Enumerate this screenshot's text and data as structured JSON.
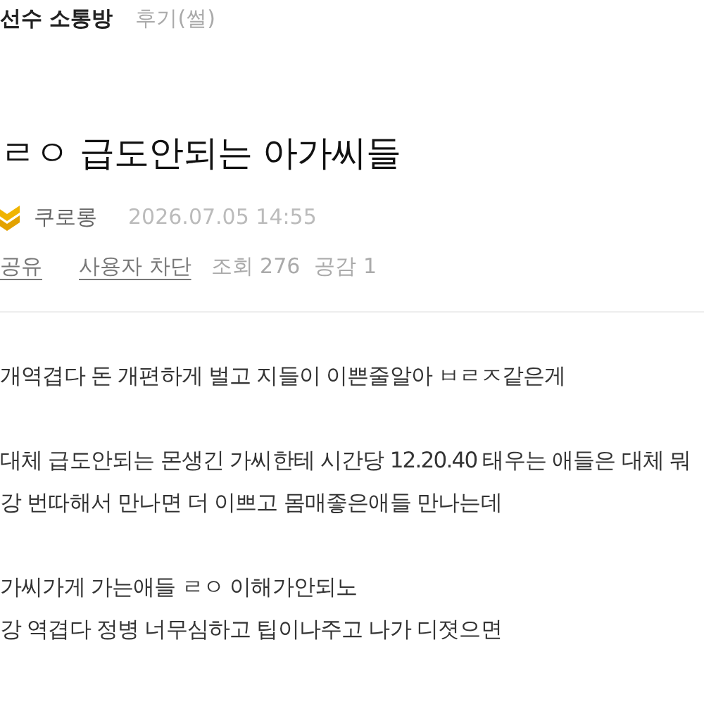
{
  "board": {
    "name": "선수 소통방",
    "category": "후기(썰)"
  },
  "post": {
    "title": "ㄹㅇ 급도안되는 아가씨들",
    "author": "쿠로롱",
    "date": "2026.07.05 14:55",
    "actions": [
      {
        "label": "공유"
      },
      {
        "label": "사용자 차단"
      }
    ],
    "stats": [
      {
        "label": "조회 276"
      },
      {
        "label": "공감 1"
      }
    ]
  },
  "body": [
    {
      "kind": "line",
      "text": "개역겹다 돈 개편하게 벌고 지들이 이쁜줄알아 ㅂㄹㅈ같은게"
    },
    {
      "kind": "blank"
    },
    {
      "kind": "line",
      "text": "대체 급도안되는 몬생긴 가씨한테 시간당 12.20.40 태우는 애들은 대체 뭐"
    },
    {
      "kind": "line",
      "text": "강 번따해서 만나면 더 이쁘고 몸매좋은애들 만나는데"
    },
    {
      "kind": "blank"
    },
    {
      "kind": "line",
      "text": "가씨가게 가는애들 ㄹㅇ 이해가안되노"
    },
    {
      "kind": "line",
      "text": "강 역겹다 정병 너무심하고 팁이나주고 나가 디졋으면"
    }
  ]
}
